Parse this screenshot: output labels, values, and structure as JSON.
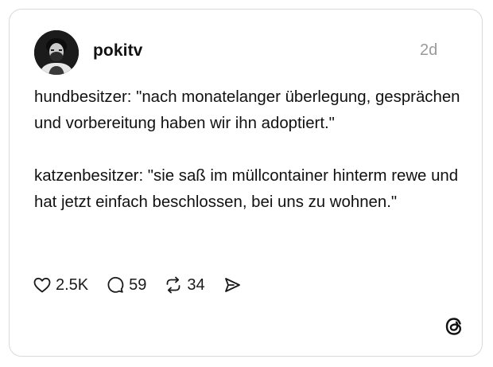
{
  "post": {
    "username": "pokitv",
    "timestamp": "2d",
    "paragraphs": [
      "hundbesitzer: \"nach monatelanger überlegung, gesprächen und vorbereitung haben wir ihn adoptiert.\"",
      "katzenbesitzer: \"sie saß im müllcontainer hinterm rewe und hat jetzt einfach beschlossen, bei uns zu wohnen.\""
    ]
  },
  "actions": {
    "likes": "2.5K",
    "replies": "59",
    "reposts": "34"
  },
  "icons": {
    "like": "heart-icon",
    "reply": "speech-bubble-icon",
    "repost": "repost-arrows-icon",
    "share": "send-icon",
    "brand": "threads-logo-icon"
  },
  "colors": {
    "text": "#111111",
    "muted": "#9a9a9a",
    "border": "#d9d9d9"
  }
}
